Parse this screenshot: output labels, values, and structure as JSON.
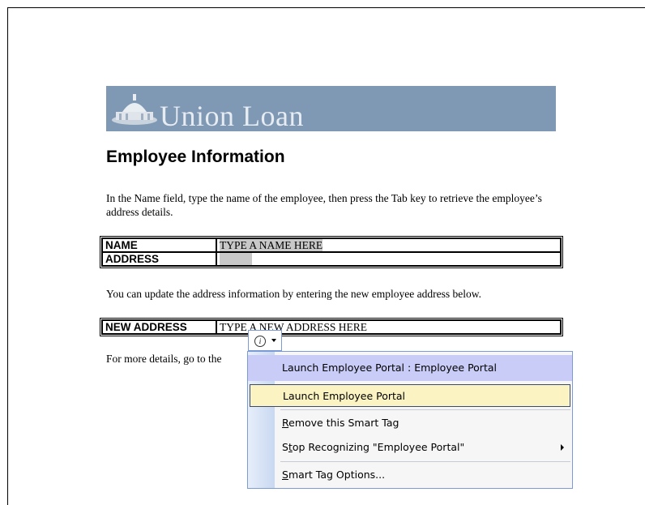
{
  "banner": {
    "company": "Union Loan"
  },
  "doc": {
    "title": "Employee Information",
    "intro": "In the Name field, type the name of the employee, then press the Tab key to retrieve the employee’s address details.",
    "update_text": "You can update the address information by entering the new employee address below.",
    "more_details": "For more details, go to the"
  },
  "table1": {
    "rows": [
      {
        "label": "NAME",
        "value": "TYPE A NAME HERE"
      },
      {
        "label": "ADDRESS",
        "value": ""
      }
    ]
  },
  "table2": {
    "rows": [
      {
        "label": "NEW ADDRESS",
        "value": "TYPE A NEW ADDRESS HERE"
      }
    ]
  },
  "smart_tag": {
    "button_icon": "info-icon",
    "menu": {
      "header": "Launch Employee Portal : Employee Portal",
      "launch": "Launch Employee Portal",
      "remove_pre": "",
      "remove_u": "R",
      "remove_post": "emove this Smart Tag",
      "stop_pre": "S",
      "stop_u": "t",
      "stop_post": "op Recognizing \"Employee Portal\"",
      "options_pre": "",
      "options_u": "S",
      "options_post": "mart Tag Options..."
    }
  }
}
